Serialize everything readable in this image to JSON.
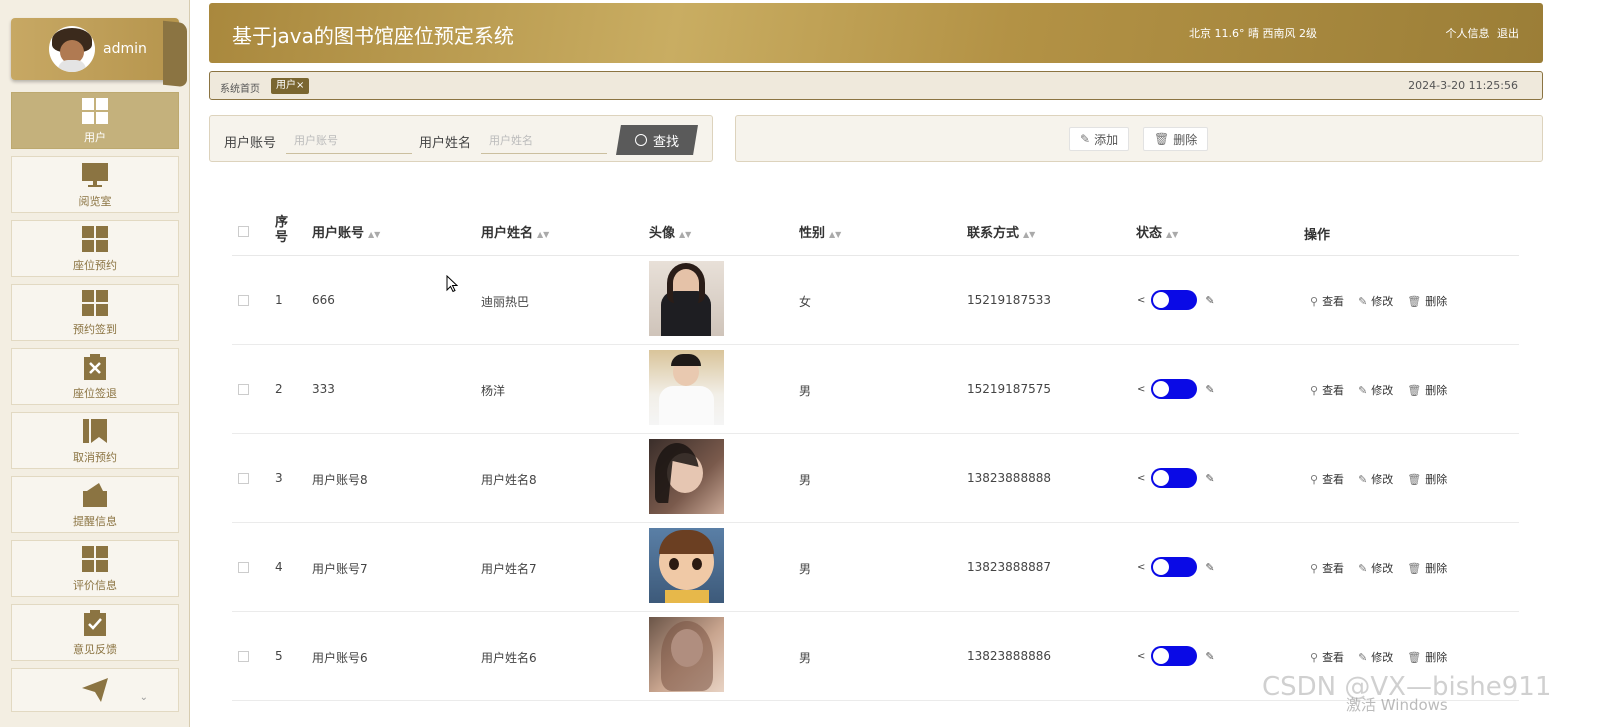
{
  "sidebar": {
    "username": "admin",
    "items": [
      {
        "label": "用户",
        "icon": "grid-icon",
        "active": true
      },
      {
        "label": "阅览室",
        "icon": "monitor-icon",
        "active": false
      },
      {
        "label": "座位预约",
        "icon": "grid-icon",
        "active": false
      },
      {
        "label": "预约签到",
        "icon": "grid-icon",
        "active": false
      },
      {
        "label": "座位签退",
        "icon": "clipboard-x-icon",
        "active": false
      },
      {
        "label": "取消预约",
        "icon": "bookmark-icon",
        "active": false
      },
      {
        "label": "提醒信息",
        "icon": "wallet-icon",
        "active": false
      },
      {
        "label": "评价信息",
        "icon": "grid-icon",
        "active": false
      },
      {
        "label": "意见反馈",
        "icon": "clipboard-check-icon",
        "active": false
      },
      {
        "label": "",
        "icon": "paper-plane-icon",
        "active": false
      }
    ]
  },
  "header": {
    "title": "基于java的图书馆座位预定系统",
    "weather": "北京  11.6°  晴  西南风  2级",
    "profile_link": "个人信息",
    "logout_link": "退出"
  },
  "breadcrumb": {
    "home": "系统首页",
    "tag": "用户×",
    "datetime": "2024-3-20 11:25:56"
  },
  "search": {
    "account_label": "用户账号",
    "account_placeholder": "用户账号",
    "name_label": "用户姓名",
    "name_placeholder": "用户姓名",
    "find_label": "查找"
  },
  "actions": {
    "add_label": "添加",
    "delete_label": "删除"
  },
  "table": {
    "columns": [
      "序号",
      "用户账号",
      "用户姓名",
      "头像",
      "性别",
      "联系方式",
      "状态",
      "操作"
    ],
    "ops": {
      "view": "查看",
      "edit": "修改",
      "delete": "删除"
    },
    "rows": [
      {
        "index": "1",
        "account": "666",
        "name": "迪丽热巴",
        "gender": "女",
        "phone": "15219187533",
        "status_on": true
      },
      {
        "index": "2",
        "account": "333",
        "name": "杨洋",
        "gender": "男",
        "phone": "15219187575",
        "status_on": true
      },
      {
        "index": "3",
        "account": "用户账号8",
        "name": "用户姓名8",
        "gender": "男",
        "phone": "13823888888",
        "status_on": true
      },
      {
        "index": "4",
        "account": "用户账号7",
        "name": "用户姓名7",
        "gender": "男",
        "phone": "13823888887",
        "status_on": true
      },
      {
        "index": "5",
        "account": "用户账号6",
        "name": "用户姓名6",
        "gender": "男",
        "phone": "13823888886",
        "status_on": true
      }
    ]
  },
  "colors": {
    "accent": "#b39245",
    "switch_on": "#0a0ae6",
    "sidebar_icon": "#8b7442"
  },
  "watermark": {
    "csdn": "CSDN @VX—bishe911",
    "windows": "激活 Windows"
  }
}
